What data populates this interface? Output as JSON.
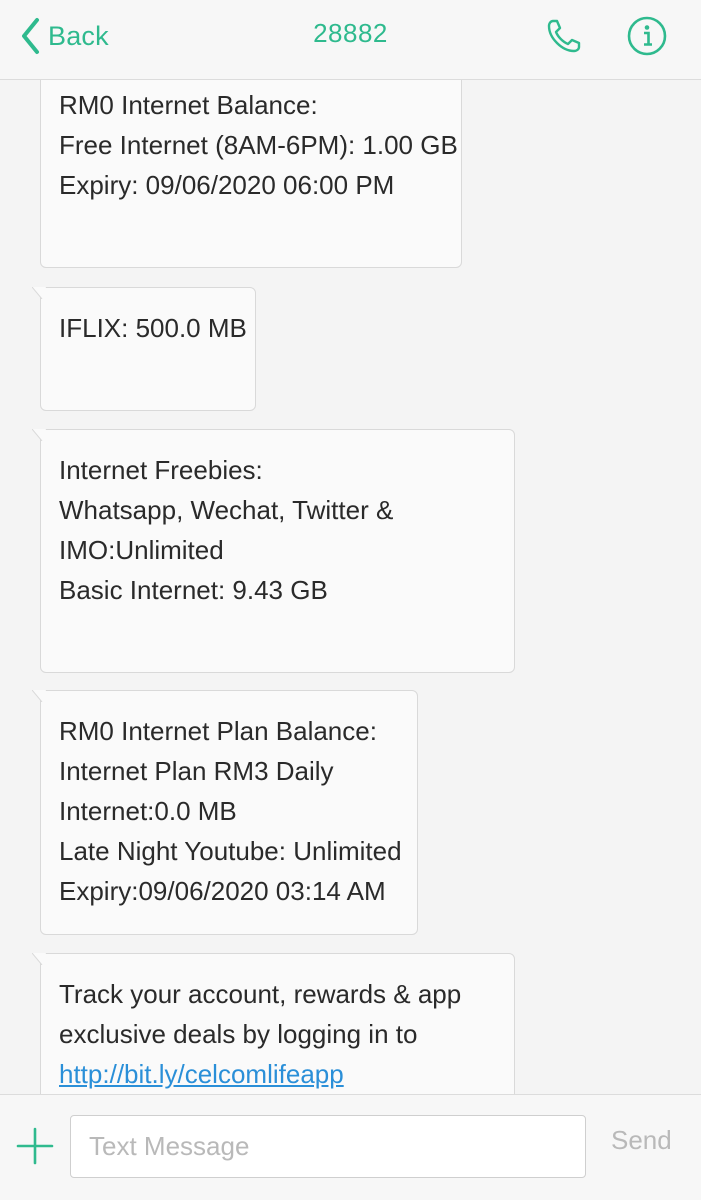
{
  "header": {
    "back_label": "Back",
    "title": "28882",
    "accent_color": "#2fba8e",
    "icons": [
      "chevron-left-icon",
      "phone-icon",
      "info-icon"
    ]
  },
  "messages": [
    {
      "lines": [
        "RM0 Internet Balance:",
        "Free Internet (8AM-6PM): 1.00 GB",
        "Expiry: 09/06/2020 06:00 PM"
      ]
    },
    {
      "lines": [
        "IFLIX: 500.0 MB"
      ]
    },
    {
      "lines": [
        "Internet Freebies:",
        "Whatsapp, Wechat, Twitter &",
        "IMO:Unlimited",
        "Basic Internet: 9.43 GB"
      ]
    },
    {
      "lines": [
        "RM0 Internet Plan Balance:",
        "Internet Plan RM3 Daily",
        "Internet:0.0 MB",
        "Late Night Youtube: Unlimited",
        "Expiry:09/06/2020 03:14 AM"
      ]
    },
    {
      "lines": [
        "Track your account, rewards & app",
        "exclusive deals by logging in to"
      ],
      "link": "http://bit.ly/celcomlifeapp"
    }
  ],
  "composer": {
    "placeholder": "Text Message",
    "value": "",
    "send_label": "Send",
    "icons": [
      "plus-icon"
    ]
  }
}
